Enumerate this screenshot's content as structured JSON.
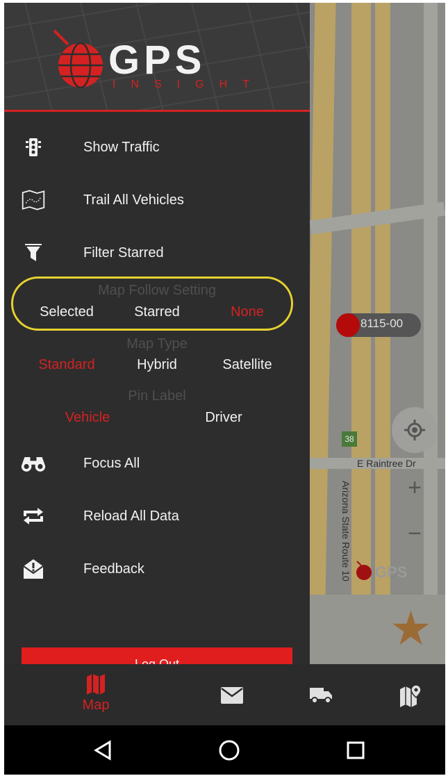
{
  "brand": {
    "logo_title": "GPS",
    "logo_subtitle": "INSIGHT"
  },
  "colors": {
    "accent": "#d42222",
    "drawer_bg": "#2d2d2d",
    "highlight_ring": "#e5d230",
    "inactive_heading": "#4f4f4f"
  },
  "menu": {
    "top_items": [
      {
        "label": "Show Traffic",
        "icon": "traffic-light-icon"
      },
      {
        "label": "Trail All Vehicles",
        "icon": "map-trail-icon"
      },
      {
        "label": "Filter Starred",
        "icon": "filter-icon"
      }
    ],
    "bottom_items": [
      {
        "label": "Focus All",
        "icon": "binoculars-icon"
      },
      {
        "label": "Reload All Data",
        "icon": "reload-icon"
      },
      {
        "label": "Feedback",
        "icon": "feedback-icon"
      }
    ]
  },
  "map_follow": {
    "title": "Map Follow Setting",
    "options": [
      "Selected",
      "Starred",
      "None"
    ],
    "selected": "None"
  },
  "map_type": {
    "title": "Map Type",
    "options": [
      "Standard",
      "Hybrid",
      "Satellite"
    ],
    "selected": "Standard"
  },
  "pin_label": {
    "title": "Pin Label",
    "options": [
      "Vehicle",
      "Driver"
    ],
    "selected": "Vehicle"
  },
  "logout": {
    "label": "Log Out"
  },
  "map": {
    "vehicle_label": "8115-00",
    "street_1": "E Raintree Dr",
    "street_2": "Arizona State Route 10",
    "route_shield": "38",
    "zoom_in": "+",
    "zoom_out": "−"
  },
  "tabbar": {
    "tabs": [
      {
        "label": "Map",
        "icon": "map-icon",
        "active": true
      },
      {
        "label": "",
        "icon": "mail-icon",
        "active": false
      },
      {
        "label": "",
        "icon": "truck-icon",
        "active": false
      },
      {
        "label": "",
        "icon": "map-pin-icon",
        "active": false
      }
    ]
  },
  "android_nav": [
    "back-icon",
    "home-icon",
    "recents-icon"
  ]
}
